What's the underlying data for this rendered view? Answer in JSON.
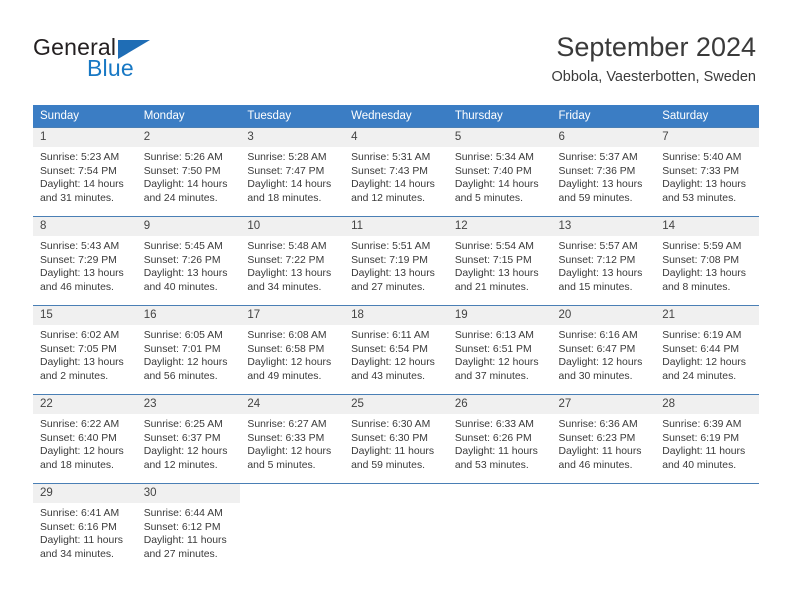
{
  "brand": {
    "name_top": "General",
    "name_bottom": "Blue",
    "triangle_icon": "triangle-icon",
    "color_dark": "#231f20",
    "color_blue": "#1878c4"
  },
  "header": {
    "title": "September 2024",
    "subtitle": "Obbola, Vaesterbotten, Sweden"
  },
  "calendar": {
    "accent_color": "#3b7dc4",
    "daynum_background": "#f0f0f0",
    "weekday_headers": [
      "Sunday",
      "Monday",
      "Tuesday",
      "Wednesday",
      "Thursday",
      "Friday",
      "Saturday"
    ],
    "weeks": [
      [
        {
          "day": "1",
          "sunrise": "Sunrise: 5:23 AM",
          "sunset": "Sunset: 7:54 PM",
          "daylight1": "Daylight: 14 hours",
          "daylight2": "and 31 minutes."
        },
        {
          "day": "2",
          "sunrise": "Sunrise: 5:26 AM",
          "sunset": "Sunset: 7:50 PM",
          "daylight1": "Daylight: 14 hours",
          "daylight2": "and 24 minutes."
        },
        {
          "day": "3",
          "sunrise": "Sunrise: 5:28 AM",
          "sunset": "Sunset: 7:47 PM",
          "daylight1": "Daylight: 14 hours",
          "daylight2": "and 18 minutes."
        },
        {
          "day": "4",
          "sunrise": "Sunrise: 5:31 AM",
          "sunset": "Sunset: 7:43 PM",
          "daylight1": "Daylight: 14 hours",
          "daylight2": "and 12 minutes."
        },
        {
          "day": "5",
          "sunrise": "Sunrise: 5:34 AM",
          "sunset": "Sunset: 7:40 PM",
          "daylight1": "Daylight: 14 hours",
          "daylight2": "and 5 minutes."
        },
        {
          "day": "6",
          "sunrise": "Sunrise: 5:37 AM",
          "sunset": "Sunset: 7:36 PM",
          "daylight1": "Daylight: 13 hours",
          "daylight2": "and 59 minutes."
        },
        {
          "day": "7",
          "sunrise": "Sunrise: 5:40 AM",
          "sunset": "Sunset: 7:33 PM",
          "daylight1": "Daylight: 13 hours",
          "daylight2": "and 53 minutes."
        }
      ],
      [
        {
          "day": "8",
          "sunrise": "Sunrise: 5:43 AM",
          "sunset": "Sunset: 7:29 PM",
          "daylight1": "Daylight: 13 hours",
          "daylight2": "and 46 minutes."
        },
        {
          "day": "9",
          "sunrise": "Sunrise: 5:45 AM",
          "sunset": "Sunset: 7:26 PM",
          "daylight1": "Daylight: 13 hours",
          "daylight2": "and 40 minutes."
        },
        {
          "day": "10",
          "sunrise": "Sunrise: 5:48 AM",
          "sunset": "Sunset: 7:22 PM",
          "daylight1": "Daylight: 13 hours",
          "daylight2": "and 34 minutes."
        },
        {
          "day": "11",
          "sunrise": "Sunrise: 5:51 AM",
          "sunset": "Sunset: 7:19 PM",
          "daylight1": "Daylight: 13 hours",
          "daylight2": "and 27 minutes."
        },
        {
          "day": "12",
          "sunrise": "Sunrise: 5:54 AM",
          "sunset": "Sunset: 7:15 PM",
          "daylight1": "Daylight: 13 hours",
          "daylight2": "and 21 minutes."
        },
        {
          "day": "13",
          "sunrise": "Sunrise: 5:57 AM",
          "sunset": "Sunset: 7:12 PM",
          "daylight1": "Daylight: 13 hours",
          "daylight2": "and 15 minutes."
        },
        {
          "day": "14",
          "sunrise": "Sunrise: 5:59 AM",
          "sunset": "Sunset: 7:08 PM",
          "daylight1": "Daylight: 13 hours",
          "daylight2": "and 8 minutes."
        }
      ],
      [
        {
          "day": "15",
          "sunrise": "Sunrise: 6:02 AM",
          "sunset": "Sunset: 7:05 PM",
          "daylight1": "Daylight: 13 hours",
          "daylight2": "and 2 minutes."
        },
        {
          "day": "16",
          "sunrise": "Sunrise: 6:05 AM",
          "sunset": "Sunset: 7:01 PM",
          "daylight1": "Daylight: 12 hours",
          "daylight2": "and 56 minutes."
        },
        {
          "day": "17",
          "sunrise": "Sunrise: 6:08 AM",
          "sunset": "Sunset: 6:58 PM",
          "daylight1": "Daylight: 12 hours",
          "daylight2": "and 49 minutes."
        },
        {
          "day": "18",
          "sunrise": "Sunrise: 6:11 AM",
          "sunset": "Sunset: 6:54 PM",
          "daylight1": "Daylight: 12 hours",
          "daylight2": "and 43 minutes."
        },
        {
          "day": "19",
          "sunrise": "Sunrise: 6:13 AM",
          "sunset": "Sunset: 6:51 PM",
          "daylight1": "Daylight: 12 hours",
          "daylight2": "and 37 minutes."
        },
        {
          "day": "20",
          "sunrise": "Sunrise: 6:16 AM",
          "sunset": "Sunset: 6:47 PM",
          "daylight1": "Daylight: 12 hours",
          "daylight2": "and 30 minutes."
        },
        {
          "day": "21",
          "sunrise": "Sunrise: 6:19 AM",
          "sunset": "Sunset: 6:44 PM",
          "daylight1": "Daylight: 12 hours",
          "daylight2": "and 24 minutes."
        }
      ],
      [
        {
          "day": "22",
          "sunrise": "Sunrise: 6:22 AM",
          "sunset": "Sunset: 6:40 PM",
          "daylight1": "Daylight: 12 hours",
          "daylight2": "and 18 minutes."
        },
        {
          "day": "23",
          "sunrise": "Sunrise: 6:25 AM",
          "sunset": "Sunset: 6:37 PM",
          "daylight1": "Daylight: 12 hours",
          "daylight2": "and 12 minutes."
        },
        {
          "day": "24",
          "sunrise": "Sunrise: 6:27 AM",
          "sunset": "Sunset: 6:33 PM",
          "daylight1": "Daylight: 12 hours",
          "daylight2": "and 5 minutes."
        },
        {
          "day": "25",
          "sunrise": "Sunrise: 6:30 AM",
          "sunset": "Sunset: 6:30 PM",
          "daylight1": "Daylight: 11 hours",
          "daylight2": "and 59 minutes."
        },
        {
          "day": "26",
          "sunrise": "Sunrise: 6:33 AM",
          "sunset": "Sunset: 6:26 PM",
          "daylight1": "Daylight: 11 hours",
          "daylight2": "and 53 minutes."
        },
        {
          "day": "27",
          "sunrise": "Sunrise: 6:36 AM",
          "sunset": "Sunset: 6:23 PM",
          "daylight1": "Daylight: 11 hours",
          "daylight2": "and 46 minutes."
        },
        {
          "day": "28",
          "sunrise": "Sunrise: 6:39 AM",
          "sunset": "Sunset: 6:19 PM",
          "daylight1": "Daylight: 11 hours",
          "daylight2": "and 40 minutes."
        }
      ],
      [
        {
          "day": "29",
          "sunrise": "Sunrise: 6:41 AM",
          "sunset": "Sunset: 6:16 PM",
          "daylight1": "Daylight: 11 hours",
          "daylight2": "and 34 minutes."
        },
        {
          "day": "30",
          "sunrise": "Sunrise: 6:44 AM",
          "sunset": "Sunset: 6:12 PM",
          "daylight1": "Daylight: 11 hours",
          "daylight2": "and 27 minutes."
        },
        {
          "day": "",
          "sunrise": "",
          "sunset": "",
          "daylight1": "",
          "daylight2": ""
        },
        {
          "day": "",
          "sunrise": "",
          "sunset": "",
          "daylight1": "",
          "daylight2": ""
        },
        {
          "day": "",
          "sunrise": "",
          "sunset": "",
          "daylight1": "",
          "daylight2": ""
        },
        {
          "day": "",
          "sunrise": "",
          "sunset": "",
          "daylight1": "",
          "daylight2": ""
        },
        {
          "day": "",
          "sunrise": "",
          "sunset": "",
          "daylight1": "",
          "daylight2": ""
        }
      ]
    ]
  }
}
